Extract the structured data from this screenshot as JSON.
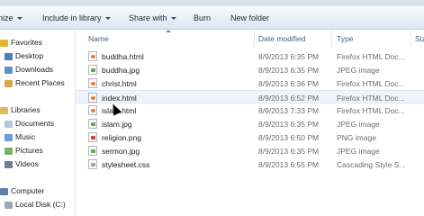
{
  "toolbar": {
    "items": [
      {
        "label": "nize",
        "dropdown": true
      },
      {
        "label": "Include in library",
        "dropdown": true
      },
      {
        "label": "Share with",
        "dropdown": true
      },
      {
        "label": "Burn",
        "dropdown": false
      },
      {
        "label": "New folder",
        "dropdown": false
      }
    ]
  },
  "nav": {
    "items": [
      {
        "label": "Favorites",
        "icon": "star-icon",
        "color": "#e8b52a"
      },
      {
        "label": "Desktop",
        "icon": "desktop-icon",
        "color": "#4a7fc0"
      },
      {
        "label": "Downloads",
        "icon": "downloads-icon",
        "color": "#5a8fd0"
      },
      {
        "label": "Recent Places",
        "icon": "recent-places-icon",
        "color": "#d8a84a"
      },
      {
        "label": "Libraries",
        "icon": "libraries-icon",
        "color": "#e2b85c"
      },
      {
        "label": "Documents",
        "icon": "documents-icon",
        "color": "#b8c6d6"
      },
      {
        "label": "Music",
        "icon": "music-icon",
        "color": "#6a9ad8"
      },
      {
        "label": "Pictures",
        "icon": "pictures-icon",
        "color": "#7fb06a"
      },
      {
        "label": "Videos",
        "icon": "videos-icon",
        "color": "#6f7f96"
      },
      {
        "label": "Computer",
        "icon": "computer-icon",
        "color": "#5b7fae"
      },
      {
        "label": "Local Disk (C:)",
        "icon": "local-disk-icon",
        "color": "#9aa7b6"
      }
    ]
  },
  "columns": {
    "name": "Name",
    "date": "Date modified",
    "type": "Type",
    "size": "Siz"
  },
  "files": [
    {
      "name": "buddha.html",
      "date": "8/9/2013 6:35 PM",
      "type": "Firefox HTML Doc...",
      "kind": "html"
    },
    {
      "name": "buddha.jpg",
      "date": "8/9/2013 6:35 PM",
      "type": "JPEG image",
      "kind": "jpg"
    },
    {
      "name": "christ.html",
      "date": "8/9/2013 6:36 PM",
      "type": "Firefox HTML Doc...",
      "kind": "html"
    },
    {
      "name": "index.html",
      "date": "8/9/2013 6:52 PM",
      "type": "Firefox HTML Doc...",
      "kind": "html"
    },
    {
      "name": "islam.html",
      "date": "8/9/2013 7:33 PM",
      "type": "Firefox HTML Doc...",
      "kind": "html"
    },
    {
      "name": "islam.jpg",
      "date": "8/9/2013 6:35 PM",
      "type": "JPEG image",
      "kind": "jpg"
    },
    {
      "name": "religion.png",
      "date": "8/9/2013 6:50 PM",
      "type": "PNG image",
      "kind": "png"
    },
    {
      "name": "sermon.jpg",
      "date": "8/9/2013 6:35 PM",
      "type": "JPEG image",
      "kind": "jpg"
    },
    {
      "name": "stylesheet.css",
      "date": "8/9/2013 6:55 PM",
      "type": "Cascading Style S...",
      "kind": "css"
    }
  ]
}
